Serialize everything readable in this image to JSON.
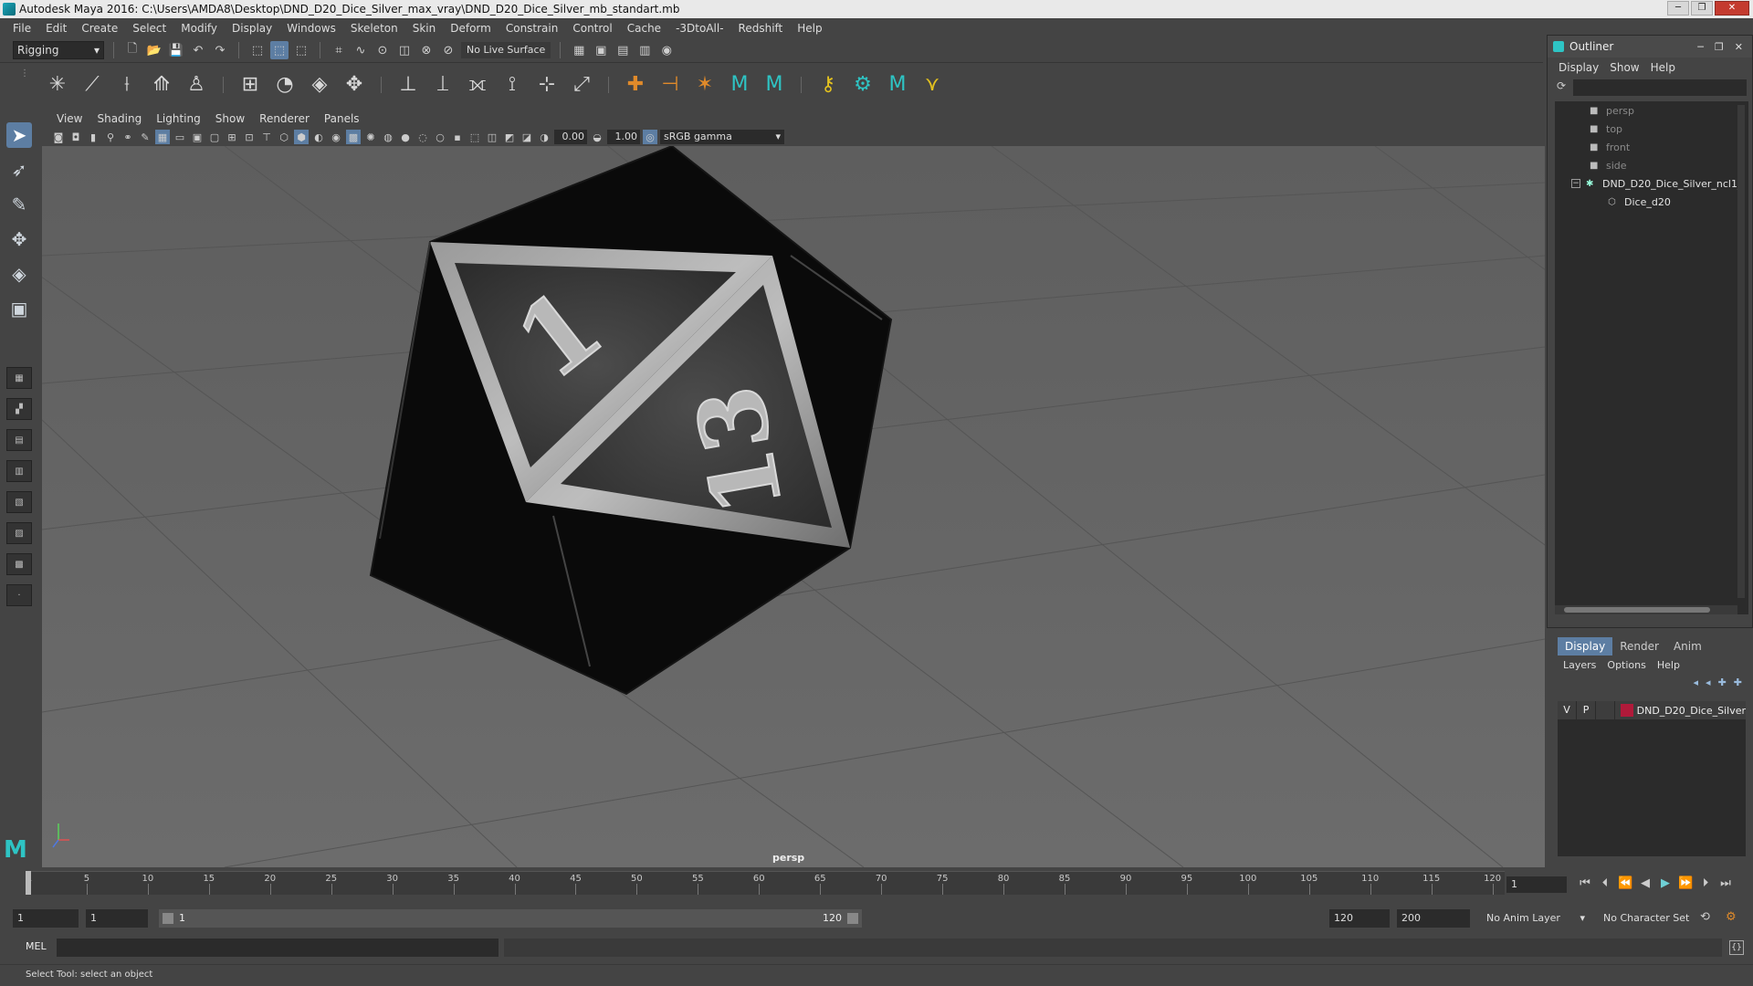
{
  "window": {
    "title": "Autodesk Maya 2016: C:\\Users\\AMDA8\\Desktop\\DND_D20_Dice_Silver_max_vray\\DND_D20_Dice_Silver_mb_standart.mb",
    "minimize": "─",
    "maximize": "❐",
    "close": "✕"
  },
  "menubar": [
    "File",
    "Edit",
    "Create",
    "Select",
    "Modify",
    "Display",
    "Windows",
    "Skeleton",
    "Skin",
    "Deform",
    "Constrain",
    "Control",
    "Cache",
    "-3DtoAll-",
    "Redshift",
    "Help"
  ],
  "statusline": {
    "mode": "Rigging",
    "live_surface": "No Live Surface"
  },
  "viewport": {
    "menu": [
      "View",
      "Shading",
      "Lighting",
      "Show",
      "Renderer",
      "Panels"
    ],
    "exposure": "0.00",
    "gamma": "1.00",
    "color_space": "sRGB gamma",
    "camera_label": "persp",
    "dice_faces": {
      "top_face": "1",
      "bottom_face": "13"
    }
  },
  "outliner": {
    "title": "Outliner",
    "menu": [
      "Display",
      "Show",
      "Help"
    ],
    "items": [
      {
        "label": "persp",
        "type": "camera"
      },
      {
        "label": "top",
        "type": "camera"
      },
      {
        "label": "front",
        "type": "camera"
      },
      {
        "label": "side",
        "type": "camera"
      },
      {
        "label": "DND_D20_Dice_Silver_ncl1_",
        "type": "group"
      },
      {
        "label": "Dice_d20",
        "type": "mesh"
      }
    ]
  },
  "layer_editor": {
    "tabs": [
      "Display",
      "Render",
      "Anim"
    ],
    "menu": [
      "Layers",
      "Options",
      "Help"
    ],
    "layer": {
      "v": "V",
      "p": "P",
      "name": "DND_D20_Dice_Silver",
      "color": "#b01a3a"
    }
  },
  "timeslider": {
    "ticks": [
      5,
      10,
      15,
      20,
      25,
      30,
      35,
      40,
      45,
      50,
      55,
      60,
      65,
      70,
      75,
      80,
      85,
      90,
      95,
      100,
      105,
      110,
      115,
      120
    ],
    "start_label": "1",
    "current_frame": "1"
  },
  "rangeslider": {
    "start": "1",
    "playback_start": "1",
    "range_start_label": "1",
    "range_end_label": "120",
    "playback_end": "120",
    "end": "200",
    "anim_layer": "No Anim Layer",
    "character_set": "No Character Set"
  },
  "cmdline": {
    "label": "MEL"
  },
  "helpline": {
    "text": "Select Tool: select an object"
  }
}
